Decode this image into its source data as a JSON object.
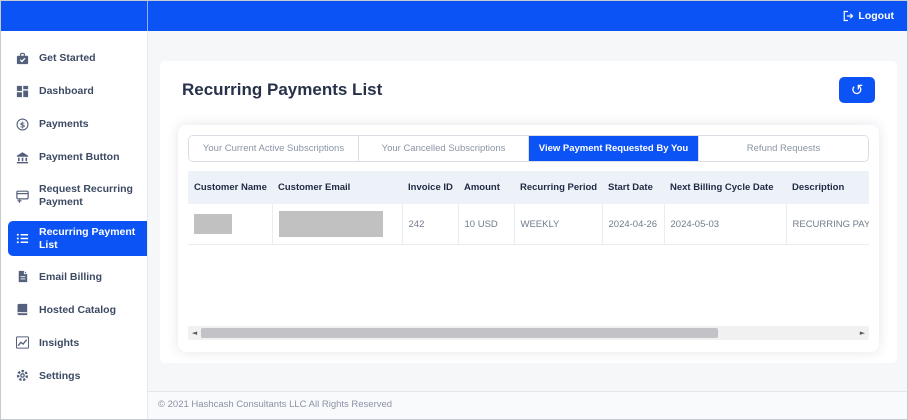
{
  "topbar": {
    "logout_label": "Logout"
  },
  "sidebar": {
    "items": [
      {
        "label": "Get Started",
        "icon": "briefcase-check",
        "active": false
      },
      {
        "label": "Dashboard",
        "icon": "dashboard-grid",
        "active": false
      },
      {
        "label": "Payments",
        "icon": "dollar-circle",
        "active": false
      },
      {
        "label": "Payment Button",
        "icon": "bank",
        "active": false
      },
      {
        "label": "Request Recurring Payment",
        "icon": "card-plus",
        "active": false
      },
      {
        "label": "Recurring Payment List",
        "icon": "bullet-list",
        "active": true
      },
      {
        "label": "Email Billing",
        "icon": "document",
        "active": false
      },
      {
        "label": "Hosted Catalog",
        "icon": "book",
        "active": false
      },
      {
        "label": "Insights",
        "icon": "chart-line",
        "active": false
      },
      {
        "label": "Settings",
        "icon": "gear",
        "active": false
      }
    ]
  },
  "main": {
    "title": "Recurring Payments List",
    "refresh_button": {
      "icon": "history-icon",
      "glyph": "↺"
    },
    "tabs": [
      {
        "label": "Your Current Active Subscriptions",
        "active": false
      },
      {
        "label": "Your Cancelled Subscriptions",
        "active": false
      },
      {
        "label": "View Payment Requested By You",
        "active": true
      },
      {
        "label": "Refund Requests",
        "active": false
      }
    ],
    "table": {
      "columns": [
        "Customer Name",
        "Customer Email",
        "Invoice ID",
        "Amount",
        "Recurring Period",
        "Start Date",
        "Next Billing Cycle Date",
        "Description"
      ],
      "rows": [
        {
          "cells": [
            {
              "redacted": true
            },
            {
              "redacted": true
            },
            {
              "text": "242"
            },
            {
              "text": "10 USD"
            },
            {
              "text": "WEEKLY"
            },
            {
              "text": "2024-04-26"
            },
            {
              "text": "2024-05-03"
            },
            {
              "text": "RECURRING PAYMENT"
            }
          ]
        }
      ]
    },
    "scrollbar": {
      "left_arrow": "◄",
      "right_arrow": "►",
      "thumb_width_pct": 79,
      "thumb_position": "left"
    }
  },
  "footer": {
    "copyright": "© 2021 Hashcash Consultants LLC All Rights Reserved"
  },
  "colors": {
    "accent_blue": "#0b53f4",
    "table_header_bg": "#edf1f8",
    "redaction_gray": "#c1c1c1"
  }
}
